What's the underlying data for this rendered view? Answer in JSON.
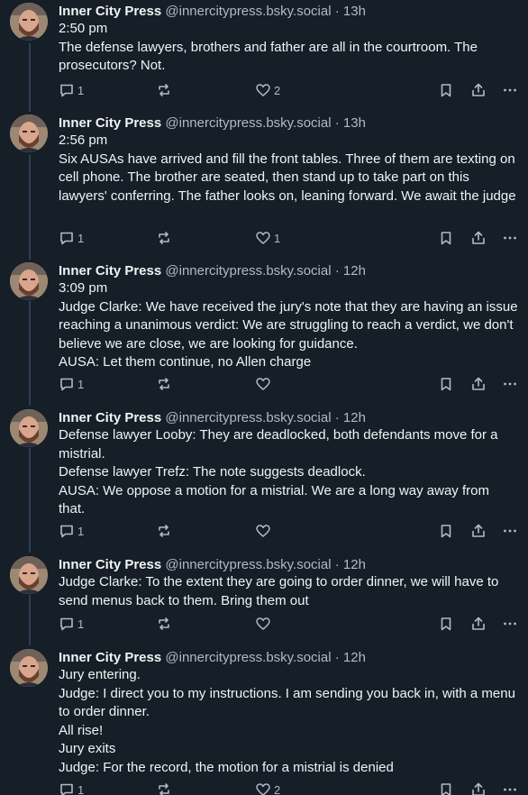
{
  "author": {
    "name": "Inner City Press",
    "handle": "@innercitypress.bsky.social"
  },
  "separator": "·",
  "colors": {
    "background": "#161e27",
    "text": "#f1f3f5",
    "muted": "#aebbc9",
    "thread_line": "#2e4052"
  },
  "posts": [
    {
      "time": "13h",
      "text": "2:50 pm\nThe defense lawyers, brothers and father are all in the courtroom. The prosecutors? Not.",
      "reply_count": "1",
      "repost_count": "",
      "like_count": "2"
    },
    {
      "time": "13h",
      "text": "2:56 pm\nSix AUSAs have arrived and fill the front tables. Three of them are texting on cell phone. The brother are seated, then stand up to take part on this lawyers' conferring. The father looks on, leaning forward. We await the judge",
      "reply_count": "1",
      "repost_count": "",
      "like_count": "1"
    },
    {
      "time": "12h",
      "text": "3:09 pm\nJudge Clarke: We have received the jury's note that they are having an issue reaching a unanimous verdict: We are struggling to reach a verdict, we don't believe we are close, we are looking for guidance.\nAUSA: Let them continue, no Allen charge",
      "reply_count": "1",
      "repost_count": "",
      "like_count": ""
    },
    {
      "time": "12h",
      "text": "Defense lawyer Looby: They are deadlocked, both defendants move for a mistrial.\nDefense lawyer Trefz: The note suggests deadlock.\nAUSA: We oppose a motion for a mistrial. We are a long way away from that.",
      "reply_count": "1",
      "repost_count": "",
      "like_count": ""
    },
    {
      "time": "12h",
      "text": "Judge Clarke: To the extent they are going to order dinner, we will have to send menus back to them. Bring them out",
      "reply_count": "1",
      "repost_count": "",
      "like_count": ""
    },
    {
      "time": "12h",
      "text": "Jury entering.\nJudge: I direct you to my instructions. I am sending you back in, with a menu to order dinner.\nAll rise!\nJury exits\nJudge: For the record, the motion for a mistrial is denied",
      "reply_count": "1",
      "repost_count": "",
      "like_count": "2"
    }
  ]
}
